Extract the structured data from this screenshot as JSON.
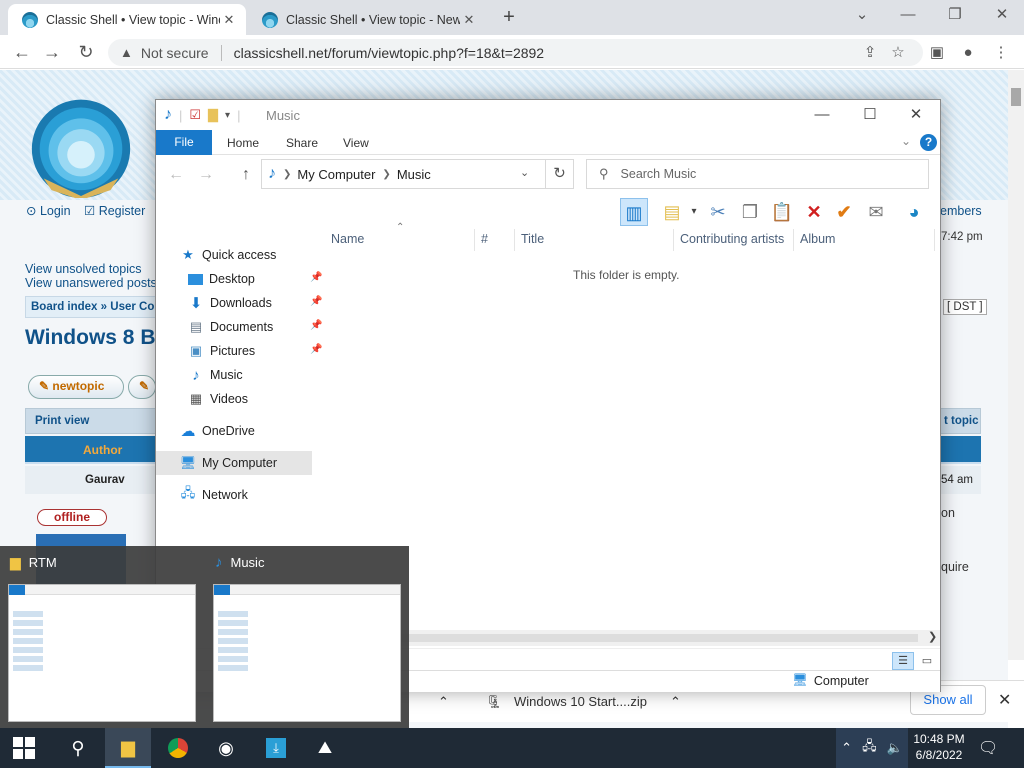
{
  "browser": {
    "tabs": [
      {
        "title": "Classic Shell • View topic - Windo",
        "active": true
      },
      {
        "title": "Classic Shell • View topic - New t",
        "active": false
      }
    ],
    "security_label": "Not secure",
    "url": "classicshell.net/forum/viewtopic.php?f=18&t=2892"
  },
  "forum": {
    "login": "Login",
    "register": "Register",
    "members": "embers",
    "time_fragment": "7:42 pm",
    "unsolved": "View unsolved topics",
    "unanswered": "View unanswered posts",
    "board_index": "Board index",
    "board_sep": "» User Co",
    "dst": "[ DST ]",
    "topic_title": "Windows 8 Bu",
    "new_topic": "newtopic",
    "print_view": "Print view",
    "next_topic": "t topic",
    "author_header": "Author",
    "author_name": "Gaurav",
    "post_time_fragment": "54 am",
    "text_fragment_1": "on",
    "text_fragment_2": "quire",
    "offline": "offline"
  },
  "downloads": {
    "file": "Windows 10 Start....zip",
    "show_all": "Show all"
  },
  "explorer": {
    "title": "Music",
    "ribbon_tabs": [
      "File",
      "Home",
      "Share",
      "View"
    ],
    "breadcrumb": [
      "My Computer",
      "Music"
    ],
    "search_placeholder": "Search Music",
    "columns": [
      "Name",
      "#",
      "Title",
      "Contributing artists",
      "Album"
    ],
    "empty_message": "This folder is empty.",
    "nav": {
      "quick_access": "Quick access",
      "desktop": "Desktop",
      "downloads": "Downloads",
      "documents": "Documents",
      "pictures": "Pictures",
      "music": "Music",
      "videos": "Videos",
      "onedrive": "OneDrive",
      "my_computer": "My Computer",
      "network": "Network"
    },
    "status_location": "Computer"
  },
  "taskbar_popup": {
    "cards": [
      {
        "label": "RTM"
      },
      {
        "label": "Music"
      }
    ]
  },
  "taskbar": {
    "time": "10:48 PM",
    "date": "6/8/2022"
  },
  "colors": {
    "forum_blue": "#105289",
    "explorer_accent": "#1979ca",
    "taskbar": "#1f2a36"
  }
}
